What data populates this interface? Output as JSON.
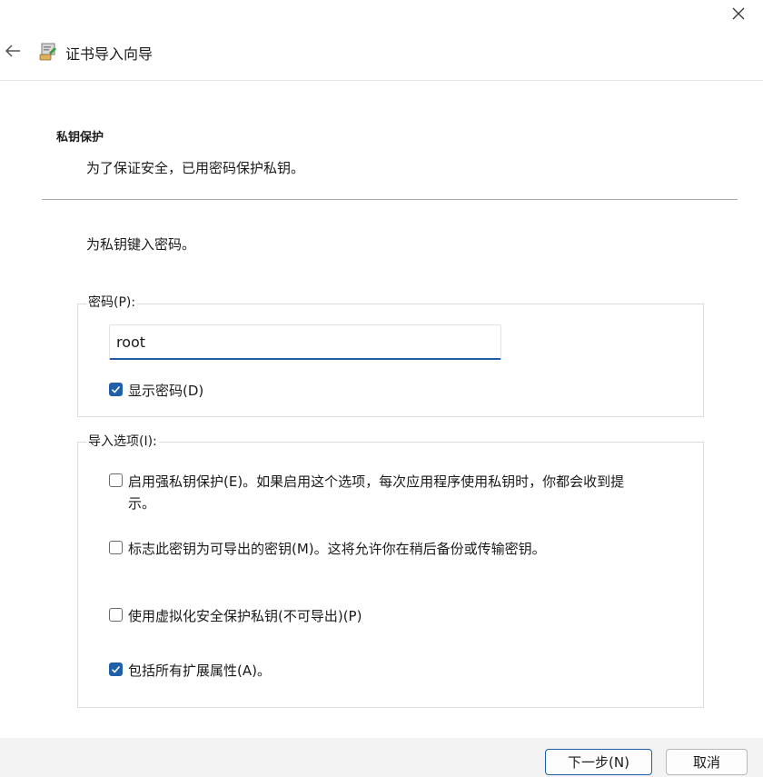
{
  "window": {
    "close_icon": "close-icon"
  },
  "header": {
    "back_icon": "back-arrow-icon",
    "app_icon": "certificate-import-icon",
    "title": "证书导入向导"
  },
  "section": {
    "heading": "私钥保护",
    "subheading": "为了保证安全，已用密码保护私钥。"
  },
  "prompt": "为私钥键入密码。",
  "password_group": {
    "label": "密码(P):",
    "value": "root",
    "show_password": {
      "label": "显示密码(D)",
      "checked": true
    }
  },
  "import_options": {
    "label": "导入选项(I):",
    "options": [
      {
        "line1": "启用强私钥保护(E)。如果启用这个选项，每次应用程序使用私钥时，你都会收到提",
        "line2": "示。",
        "checked": false
      },
      {
        "line1": "标志此密钥为可导出的密钥(M)。这将允许你在稍后备份或传输密钥。",
        "line2": "",
        "checked": false
      },
      {
        "line1": "使用虚拟化安全保护私钥(不可导出)(P)",
        "line2": "",
        "checked": false
      },
      {
        "line1": "包括所有扩展属性(A)。",
        "line2": "",
        "checked": true
      }
    ]
  },
  "footer": {
    "next_label": "下一步(N)",
    "cancel_label": "取消"
  },
  "colors": {
    "accent": "#1f5fa8",
    "footer_bg": "#f3f3f3"
  }
}
